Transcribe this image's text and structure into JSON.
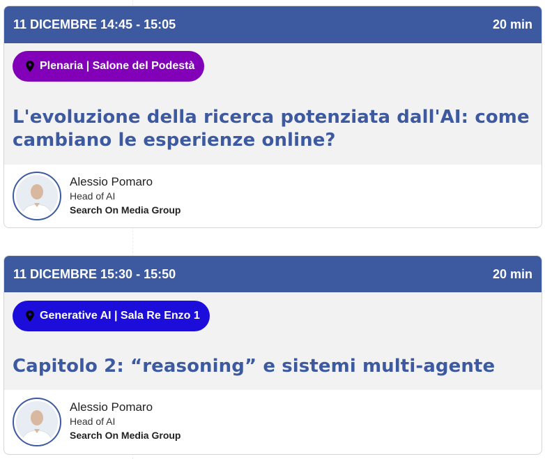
{
  "sessions": [
    {
      "datetime": "11 DICEMBRE 14:45 - 15:05",
      "duration": "20 min",
      "location": "Plenaria | Salone del Podestà",
      "location_color": "#8200b8",
      "title": "L'evoluzione della ricerca potenziata dall'AI: come cambiano le esperienze online?",
      "speaker": {
        "name": "Alessio Pomaro",
        "role": "Head of AI",
        "company": "Search On Media Group"
      }
    },
    {
      "datetime": "11 DICEMBRE 15:30 - 15:50",
      "duration": "20 min",
      "location": "Generative AI | Sala Re Enzo 1",
      "location_color": "#1c0ddb",
      "title": "Capitolo 2: “reasoning” e sistemi multi-agente",
      "speaker": {
        "name": "Alessio Pomaro",
        "role": "Head of AI",
        "company": "Search On Media Group"
      }
    }
  ],
  "colors": {
    "header": "#3d5aa1",
    "title": "#3d5aa1"
  },
  "icons": {
    "location": "map-pin-icon"
  }
}
